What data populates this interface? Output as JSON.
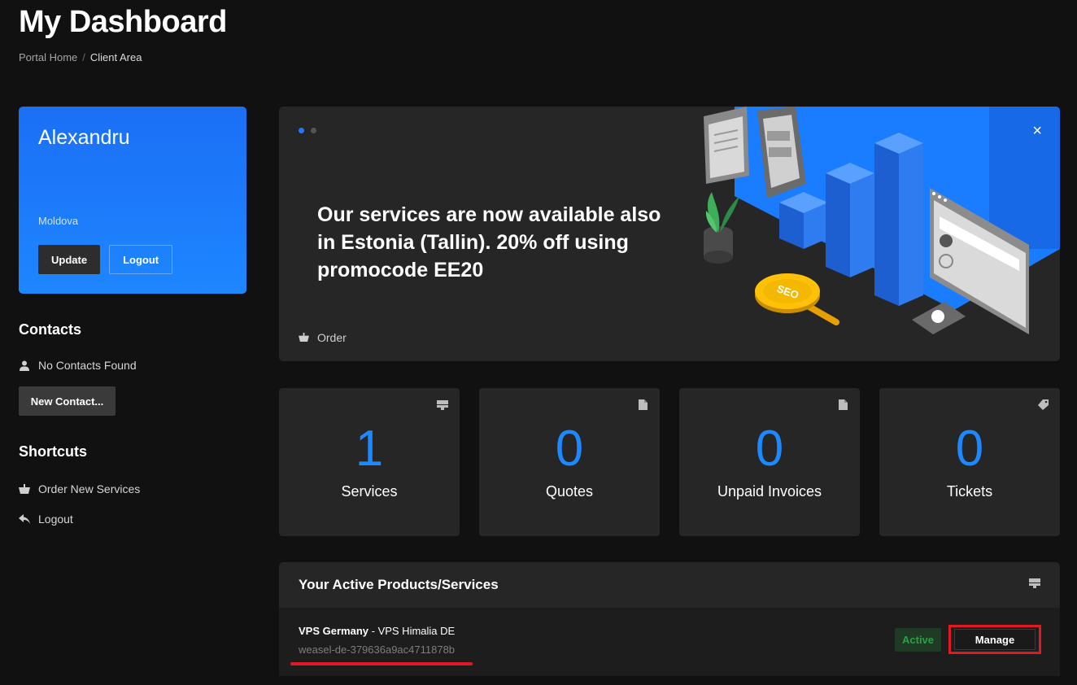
{
  "page": {
    "title": "My Dashboard",
    "breadcrumb": {
      "home": "Portal Home",
      "separator": "/",
      "current": "Client Area"
    }
  },
  "profile": {
    "name": "Alexandru",
    "country": "Moldova",
    "update_label": "Update",
    "logout_label": "Logout"
  },
  "contacts": {
    "heading": "Contacts",
    "empty_text": "No Contacts Found",
    "new_contact_label": "New Contact..."
  },
  "shortcuts": {
    "heading": "Shortcuts",
    "items": [
      {
        "label": "Order New Services",
        "icon": "basket-icon"
      },
      {
        "label": "Logout",
        "icon": "reply-arrow-icon"
      }
    ]
  },
  "banner": {
    "text": "Our services are now available also in Estonia (Tallin). 20% off using promocode EE20",
    "order_label": "Order",
    "close_symbol": "×",
    "seo_label": "SEO",
    "slide_count": 2,
    "active_slide": 1,
    "colors": {
      "accent": "#1f78ff"
    }
  },
  "stats": [
    {
      "value": "1",
      "label": "Services",
      "icon": "server-icon"
    },
    {
      "value": "0",
      "label": "Quotes",
      "icon": "document-icon"
    },
    {
      "value": "0",
      "label": "Unpaid Invoices",
      "icon": "document-icon"
    },
    {
      "value": "0",
      "label": "Tickets",
      "icon": "tag-icon"
    }
  ],
  "products": {
    "title": "Your Active Products/Services",
    "items": [
      {
        "product": "VPS Germany",
        "separator": " - ",
        "plan": "VPS Himalia DE",
        "hostname": "weasel-de-379636a9ac4711878b",
        "status": "Active",
        "manage_label": "Manage"
      }
    ]
  },
  "colors": {
    "background": "#111111",
    "panel": "#262626",
    "accent_blue": "#1e88ff",
    "highlight_red": "#e01a22",
    "status_green": "#2ea043"
  }
}
